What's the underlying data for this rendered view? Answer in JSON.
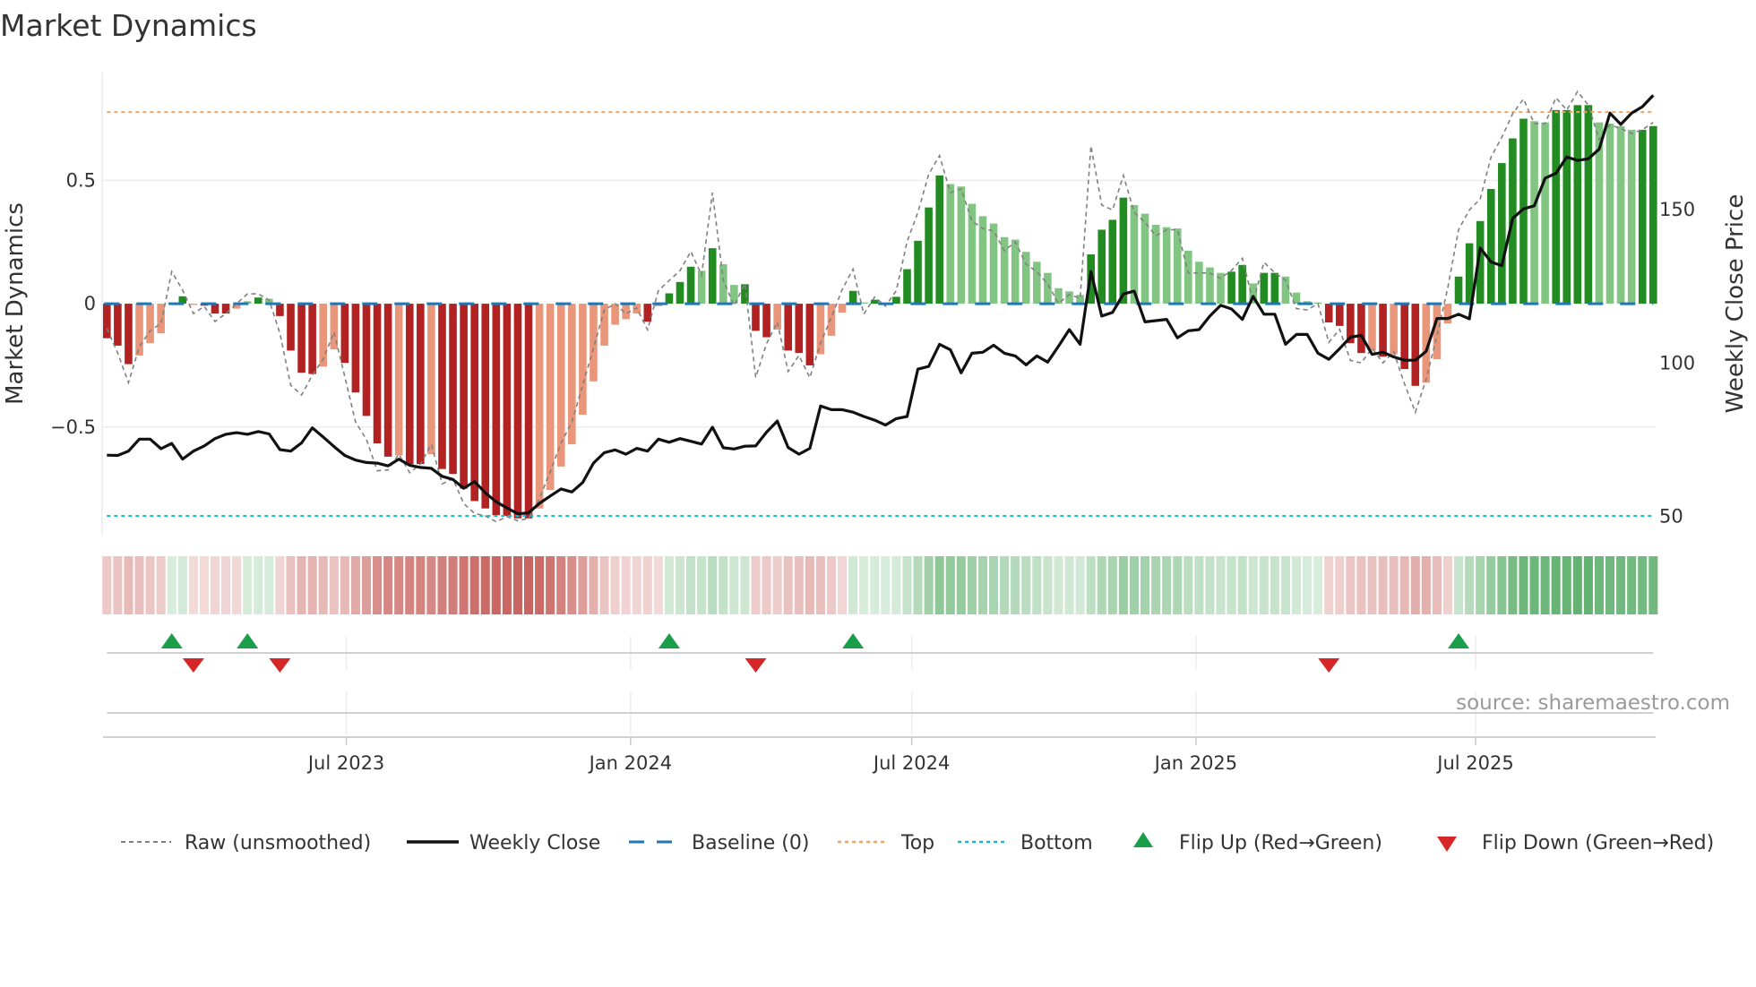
{
  "chart_data": {
    "type": "bar",
    "title": "Market Dynamics",
    "ylabel": "Market Dynamics",
    "ylabel_right": "Weekly Close Price",
    "frequency": "weekly",
    "x_start": "2023-01-27",
    "ylim": [
      -0.94,
      0.937
    ],
    "ylim_right": [
      43.8,
      194.6
    ],
    "y_ticks": [
      {
        "value": 0.5,
        "label": "0.5"
      },
      {
        "value": 0,
        "label": "0"
      },
      {
        "value": -0.5,
        "label": "−0.5"
      }
    ],
    "y_right_ticks": [
      {
        "value": 150,
        "label": "150"
      },
      {
        "value": 100,
        "label": "100"
      },
      {
        "value": 50,
        "label": "50"
      }
    ],
    "x_ticks": [
      {
        "date": "2023-07-01",
        "label": "Jul 2023"
      },
      {
        "date": "2024-01-01",
        "label": "Jan 2024"
      },
      {
        "date": "2024-07-01",
        "label": "Jul 2024"
      },
      {
        "date": "2025-01-01",
        "label": "Jan 2025"
      },
      {
        "date": "2025-07-01",
        "label": "Jul 2025"
      }
    ],
    "grid": true,
    "legend_position": "bottom",
    "reference_lines": {
      "top": 0.777,
      "bottom": -0.86,
      "baseline": 0
    },
    "series": [
      {
        "name": "Market Dynamics (smoothed)",
        "type": "bar",
        "values": [
          -0.14,
          -0.17,
          -0.245,
          -0.21,
          -0.16,
          -0.12,
          0.005,
          0.03,
          -0.005,
          -0.008,
          -0.04,
          -0.04,
          -0.02,
          0.01,
          0.025,
          0.02,
          -0.05,
          -0.19,
          -0.28,
          -0.285,
          -0.255,
          -0.185,
          -0.24,
          -0.36,
          -0.455,
          -0.566,
          -0.62,
          -0.615,
          -0.65,
          -0.65,
          -0.61,
          -0.67,
          -0.69,
          -0.75,
          -0.8,
          -0.83,
          -0.857,
          -0.86,
          -0.87,
          -0.87,
          -0.83,
          -0.755,
          -0.66,
          -0.57,
          -0.45,
          -0.315,
          -0.17,
          -0.085,
          -0.063,
          -0.04,
          -0.073,
          -0.01,
          0.042,
          0.088,
          0.15,
          0.133,
          0.225,
          0.16,
          0.076,
          0.079,
          -0.11,
          -0.136,
          -0.105,
          -0.19,
          -0.2,
          -0.25,
          -0.205,
          -0.13,
          -0.036,
          0.052,
          0.005,
          0.016,
          0.003,
          0.028,
          0.14,
          0.255,
          0.39,
          0.52,
          0.485,
          0.475,
          0.405,
          0.355,
          0.325,
          0.27,
          0.26,
          0.21,
          0.17,
          0.125,
          0.063,
          0.05,
          0.036,
          0.2,
          0.3,
          0.34,
          0.43,
          0.4,
          0.365,
          0.32,
          0.31,
          0.305,
          0.215,
          0.17,
          0.147,
          0.125,
          0.13,
          0.157,
          0.082,
          0.125,
          0.125,
          0.11,
          0.045,
          0.01,
          0.005,
          -0.076,
          -0.09,
          -0.16,
          -0.2,
          -0.19,
          -0.215,
          -0.205,
          -0.265,
          -0.333,
          -0.32,
          -0.225,
          -0.08,
          0.11,
          0.245,
          0.335,
          0.465,
          0.57,
          0.67,
          0.75,
          0.74,
          0.735,
          0.785,
          0.785,
          0.805,
          0.805,
          0.735,
          0.73,
          0.72,
          0.705,
          0.705,
          0.72
        ]
      },
      {
        "name": "Raw (unsmoothed)",
        "type": "line",
        "values": [
          -0.1,
          -0.2,
          -0.32,
          -0.175,
          -0.11,
          -0.08,
          0.13,
          0.055,
          -0.04,
          -0.011,
          -0.072,
          -0.04,
          0.0,
          0.04,
          0.04,
          0.015,
          -0.12,
          -0.33,
          -0.37,
          -0.29,
          -0.225,
          -0.115,
          -0.295,
          -0.48,
          -0.55,
          -0.677,
          -0.674,
          -0.61,
          -0.685,
          -0.65,
          -0.57,
          -0.73,
          -0.71,
          -0.81,
          -0.85,
          -0.86,
          -0.884,
          -0.863,
          -0.88,
          -0.87,
          -0.79,
          -0.68,
          -0.565,
          -0.48,
          -0.33,
          -0.18,
          -0.025,
          0.0,
          -0.041,
          -0.017,
          -0.106,
          0.053,
          0.094,
          0.134,
          0.212,
          0.116,
          0.45,
          0.095,
          -0.008,
          0.082,
          -0.299,
          -0.162,
          -0.074,
          -0.275,
          -0.21,
          -0.3,
          -0.16,
          -0.055,
          0.058,
          0.14,
          -0.042,
          0.027,
          -0.01,
          0.053,
          0.252,
          0.37,
          0.525,
          0.6,
          0.45,
          0.465,
          0.335,
          0.305,
          0.295,
          0.215,
          0.25,
          0.16,
          0.13,
          0.08,
          0.001,
          0.037,
          0.022,
          0.64,
          0.4,
          0.38,
          0.52,
          0.37,
          0.33,
          0.275,
          0.3,
          0.3,
          0.125,
          0.125,
          0.124,
          0.103,
          0.135,
          0.184,
          0.007,
          0.168,
          0.125,
          0.095,
          -0.02,
          -0.025,
          0.0,
          -0.157,
          -0.104,
          -0.23,
          -0.24,
          -0.18,
          -0.24,
          -0.195,
          -0.325,
          -0.44,
          -0.307,
          -0.13,
          0.065,
          0.3,
          0.38,
          0.425,
          0.595,
          0.675,
          0.77,
          0.83,
          0.73,
          0.73,
          0.835,
          0.785,
          0.86,
          0.805,
          0.665,
          0.725,
          0.71,
          0.69,
          0.705,
          0.735
        ]
      },
      {
        "name": "Weekly Close",
        "type": "line",
        "axis": "right",
        "values": [
          70.0,
          69.9,
          71.3,
          75.2,
          75.2,
          72.1,
          73.8,
          68.7,
          71.3,
          73.0,
          75.4,
          76.8,
          77.3,
          76.8,
          77.7,
          76.9,
          71.8,
          71.3,
          74.0,
          78.9,
          75.9,
          72.8,
          69.9,
          68.4,
          67.6,
          67.4,
          66.5,
          68.7,
          66.7,
          66.0,
          65.7,
          63.1,
          62.1,
          59.2,
          61.4,
          57.7,
          54.8,
          52.8,
          50.9,
          51.2,
          54.3,
          56.7,
          59.0,
          58.0,
          61.1,
          67.4,
          70.8,
          71.7,
          70.3,
          72.2,
          71.3,
          75.2,
          74.2,
          75.4,
          74.5,
          73.6,
          79.1,
          72.4,
          72.0,
          72.9,
          73.0,
          77.5,
          81.1,
          72.5,
          70.3,
          72.2,
          86.0,
          84.8,
          84.8,
          84.0,
          82.6,
          81.4,
          79.8,
          81.9,
          82.6,
          98.0,
          98.9,
          106.1,
          104.3,
          96.8,
          103.2,
          103.5,
          105.8,
          103.2,
          102.3,
          99.4,
          102.3,
          100.3,
          105.5,
          110.9,
          106.1,
          129.8,
          115.3,
          116.5,
          122.5,
          123.4,
          113.4,
          113.8,
          114.2,
          108.2,
          110.5,
          110.9,
          115.3,
          118.8,
          117.6,
          114.2,
          121.7,
          115.9,
          115.9,
          106.1,
          109.3,
          109.3,
          103.2,
          101.2,
          104.7,
          108.4,
          109.0,
          102.8,
          103.5,
          102.0,
          100.9,
          100.9,
          103.8,
          114.5,
          114.5,
          115.9,
          114.4,
          137.5,
          132.9,
          131.7,
          147.1,
          150.2,
          151.2,
          160.2,
          161.8,
          167.1,
          166.0,
          166.5,
          169.7,
          181.4,
          177.7,
          181.4,
          183.5,
          187.2
        ]
      }
    ],
    "flips_up_week_index": [
      7,
      14,
      53,
      70,
      126
    ],
    "flips_down_week_index": [
      9,
      17,
      61,
      114
    ],
    "colors": {
      "bar_neg_strong": "#b22222",
      "bar_neg_weak": "#e9967a",
      "bar_pos_strong": "#228b22",
      "bar_pos_weak": "#82c582",
      "raw": "#808080",
      "close": "#111111",
      "baseline": "#1f77b4",
      "top": "#f4a261",
      "bottom": "#17becf",
      "flip_up": "#1a9e4a",
      "flip_down": "#d62728",
      "heat_neg": "#c04a45",
      "heat_pos": "#3fa050"
    }
  },
  "legend": {
    "raw": "Raw (unsmoothed)",
    "close": "Weekly Close",
    "baseline": "Baseline (0)",
    "top": "Top",
    "bottom": "Bottom",
    "flip_up": "Flip Up (Red→Green)",
    "flip_down": "Flip Down (Green→Red)"
  },
  "source": "source: sharemaestro.com"
}
